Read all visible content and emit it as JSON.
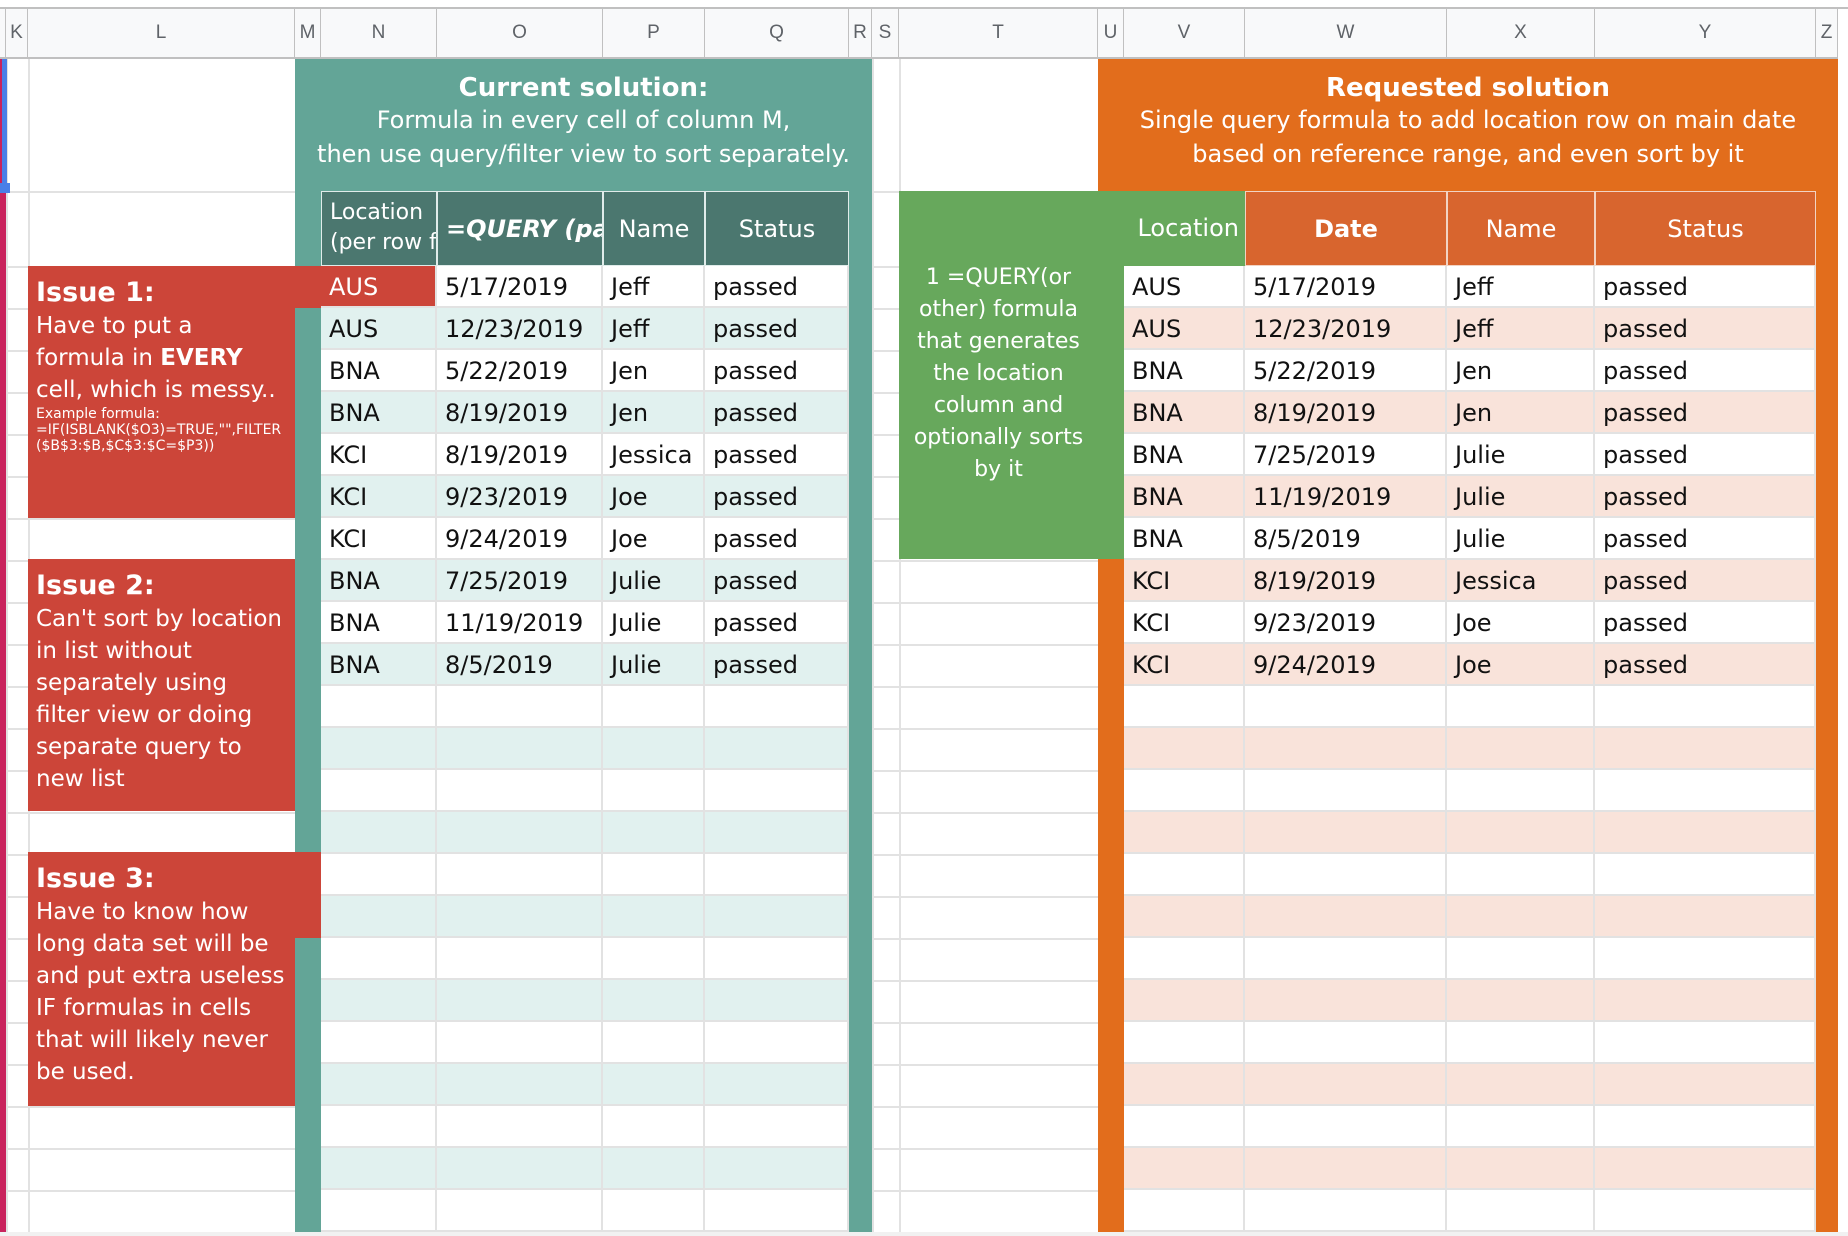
{
  "sheet": {
    "columns": [
      "K",
      "L",
      "M",
      "N",
      "O",
      "P",
      "Q",
      "R",
      "S",
      "T",
      "U",
      "V",
      "W",
      "X",
      "Y",
      "Z"
    ]
  },
  "current_solution": {
    "title": "Current solution:",
    "line1": "Formula in every cell of column M,",
    "line2": "then use query/filter view to sort separately.",
    "headers": [
      "Location\n(per row formula)",
      "=QUERY (pass",
      "Name",
      "Status"
    ],
    "header_location_line1": "Location",
    "header_location_line2": "(per row f",
    "rows": [
      [
        "AUS",
        "5/17/2019",
        "Jeff",
        "passed"
      ],
      [
        "AUS",
        "12/23/2019",
        "Jeff",
        "passed"
      ],
      [
        "BNA",
        "5/22/2019",
        "Jen",
        "passed"
      ],
      [
        "BNA",
        "8/19/2019",
        "Jen",
        "passed"
      ],
      [
        "KCI",
        "8/19/2019",
        "Jessica",
        "passed"
      ],
      [
        "KCI",
        "9/23/2019",
        "Joe",
        "passed"
      ],
      [
        "KCI",
        "9/24/2019",
        "Joe",
        "passed"
      ],
      [
        "BNA",
        "7/25/2019",
        "Julie",
        "passed"
      ],
      [
        "BNA",
        "11/19/2019",
        "Julie",
        "passed"
      ],
      [
        "BNA",
        "8/5/2019",
        "Julie",
        "passed"
      ]
    ]
  },
  "requested_solution": {
    "title": "Requested solution",
    "line1": "Single query formula to add location row on main date",
    "line2": "based on reference range, and even sort by it",
    "headers": [
      "Location",
      "Date",
      "Name",
      "Status"
    ],
    "rows": [
      [
        "AUS",
        "5/17/2019",
        "Jeff",
        "passed"
      ],
      [
        "AUS",
        "12/23/2019",
        "Jeff",
        "passed"
      ],
      [
        "BNA",
        "5/22/2019",
        "Jen",
        "passed"
      ],
      [
        "BNA",
        "8/19/2019",
        "Jen",
        "passed"
      ],
      [
        "BNA",
        "7/25/2019",
        "Julie",
        "passed"
      ],
      [
        "BNA",
        "11/19/2019",
        "Julie",
        "passed"
      ],
      [
        "BNA",
        "8/5/2019",
        "Julie",
        "passed"
      ],
      [
        "KCI",
        "8/19/2019",
        "Jessica",
        "passed"
      ],
      [
        "KCI",
        "9/23/2019",
        "Joe",
        "passed"
      ],
      [
        "KCI",
        "9/24/2019",
        "Joe",
        "passed"
      ]
    ]
  },
  "green_note": "1 =QUERY(or other) formula that generates the location column and optionally sorts by it",
  "issues": [
    {
      "title": "Issue 1:",
      "body_pre": "Have to put a formula in ",
      "body_bold": "EVERY",
      "body_post": " cell, which is messy..",
      "example_label": "Example formula:",
      "example_formula": "=IF(ISBLANK($O3)=TRUE,\"\",FILTER($B$3:$B,$C$3:$C=$P3))"
    },
    {
      "title": "Issue 2:",
      "body": "Can't sort by location in list without separately using filter view or doing separate query to new list"
    },
    {
      "title": "Issue 3:",
      "body": "Have to know how long data set will be and put extra useless IF formulas in cells that will likely never be used."
    }
  ],
  "colors": {
    "teal": "#63a597",
    "teal_header": "#4b776f",
    "teal_row": "#e1f1ef",
    "orange": "#e26d1c",
    "orange_header": "#d8652e",
    "peach_row": "#f9e3da",
    "green": "#67a85c",
    "issue_red": "#cc4539",
    "selection_blue": "#4a7fe8"
  }
}
